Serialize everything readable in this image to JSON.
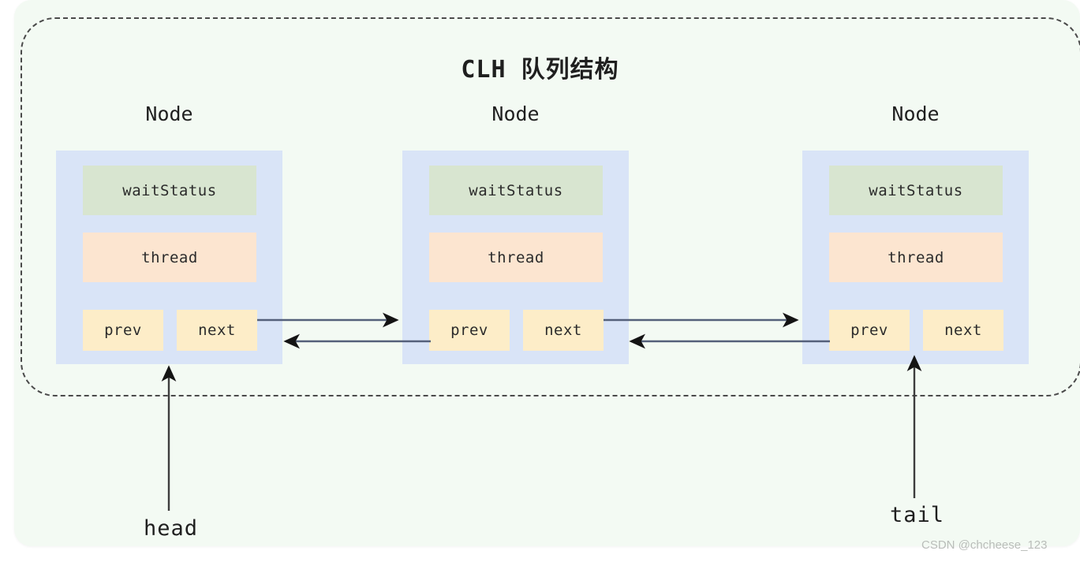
{
  "diagram": {
    "title": "CLH 队列结构",
    "background_color": "#f3faf3",
    "node_color": "#d9e4f7",
    "wait_status_color": "#d8e5d0",
    "thread_color": "#fce5d0",
    "pointer_color": "#fdedc8",
    "arrow_color": "#3d3d3d",
    "dash_border_color": "#4a4a4a"
  },
  "nodes": [
    {
      "label": "Node",
      "wait_status": "waitStatus",
      "thread": "thread",
      "prev": "prev",
      "next": "next"
    },
    {
      "label": "Node",
      "wait_status": "waitStatus",
      "thread": "thread",
      "prev": "prev",
      "next": "next"
    },
    {
      "label": "Node",
      "wait_status": "waitStatus",
      "thread": "thread",
      "prev": "prev",
      "next": "next"
    }
  ],
  "pointers": {
    "head": "head",
    "tail": "tail"
  },
  "connections": [
    {
      "from": "node0.next",
      "to": "node1",
      "direction": "right"
    },
    {
      "from": "node1.prev",
      "to": "node0",
      "direction": "left"
    },
    {
      "from": "node1.next",
      "to": "node2",
      "direction": "right"
    },
    {
      "from": "node2.prev",
      "to": "node1",
      "direction": "left"
    }
  ],
  "watermark": "CSDN @chcheese_123"
}
